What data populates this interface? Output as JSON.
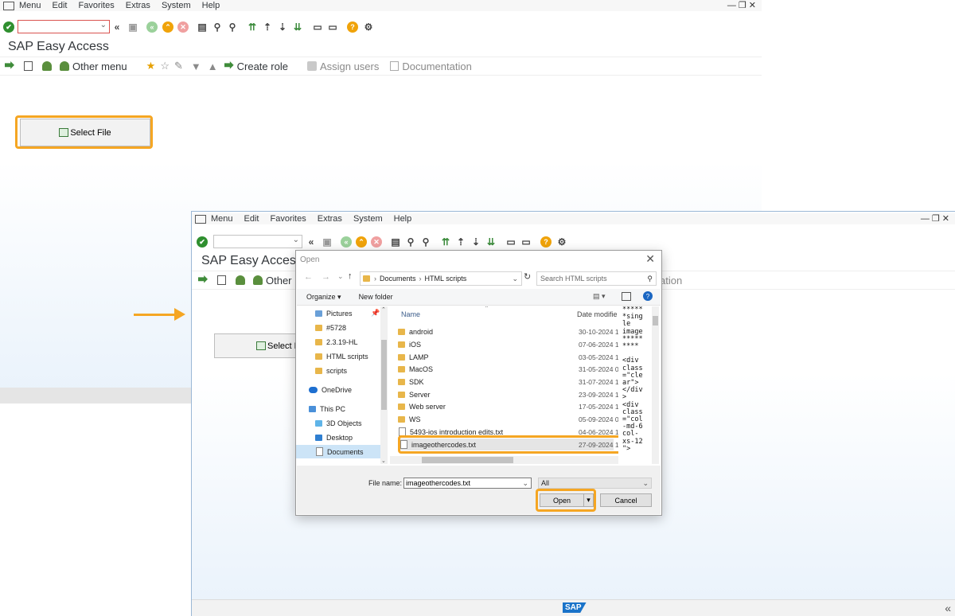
{
  "back_window": {
    "menu": [
      "Menu",
      "Edit",
      "Favorites",
      "Extras",
      "System",
      "Help"
    ],
    "title": "SAP Easy Access",
    "app_toolbar": {
      "other_menu": "Other menu",
      "create_role": "Create role",
      "assign_users": "Assign users",
      "documentation": "Documentation"
    },
    "select_file_label": "Select File"
  },
  "front_window": {
    "menu": [
      "Menu",
      "Edit",
      "Favorites",
      "Extras",
      "System",
      "Help"
    ],
    "title": "SAP Easy Access",
    "other_menu_partial": "Other",
    "documentation_partial": "ation",
    "select_file_partial": "Select Fi",
    "footer_logo": "SAP"
  },
  "open_dialog": {
    "title": "Open",
    "breadcrumb": [
      "Documents",
      "HTML scripts"
    ],
    "search_placeholder": "Search HTML scripts",
    "organize_label": "Organize",
    "new_folder_label": "New folder",
    "nav_items": [
      "Pictures",
      "#5728",
      "2.3.19-HL",
      "HTML scripts",
      "scripts",
      "OneDrive",
      "This PC",
      "3D Objects",
      "Desktop",
      "Documents"
    ],
    "column_name": "Name",
    "column_date": "Date modifie",
    "files": [
      {
        "name": "android",
        "date": "30-10-2024 1",
        "type": "folder"
      },
      {
        "name": "iOS",
        "date": "07-06-2024 1",
        "type": "folder"
      },
      {
        "name": "LAMP",
        "date": "03-05-2024 1",
        "type": "folder"
      },
      {
        "name": "MacOS",
        "date": "31-05-2024 0",
        "type": "folder"
      },
      {
        "name": "SDK",
        "date": "31-07-2024 1",
        "type": "folder"
      },
      {
        "name": "Server",
        "date": "23-09-2024 1",
        "type": "folder"
      },
      {
        "name": "Web server",
        "date": "17-05-2024 1",
        "type": "folder"
      },
      {
        "name": "WS",
        "date": "05-09-2024 0",
        "type": "folder"
      },
      {
        "name": "5493-ios introduction edits.txt",
        "date": "04-06-2024 1",
        "type": "file"
      },
      {
        "name": "imageothercodes.txt",
        "date": "27-09-2024 1",
        "type": "file"
      }
    ],
    "preview_text": "*****\n*sing\nle\nimage\n*****\n****\n\n<div\nclass\n=\"cle\nar\">\n</div\n>\n<div\nclass\n=\"col\n-md-6\ncol-\nxs-12\n\">",
    "file_name_label": "File name:",
    "file_name_value": "imageothercodes.txt",
    "file_type": "All",
    "open_label": "Open",
    "cancel_label": "Cancel"
  },
  "accent_color": "#f5a623"
}
